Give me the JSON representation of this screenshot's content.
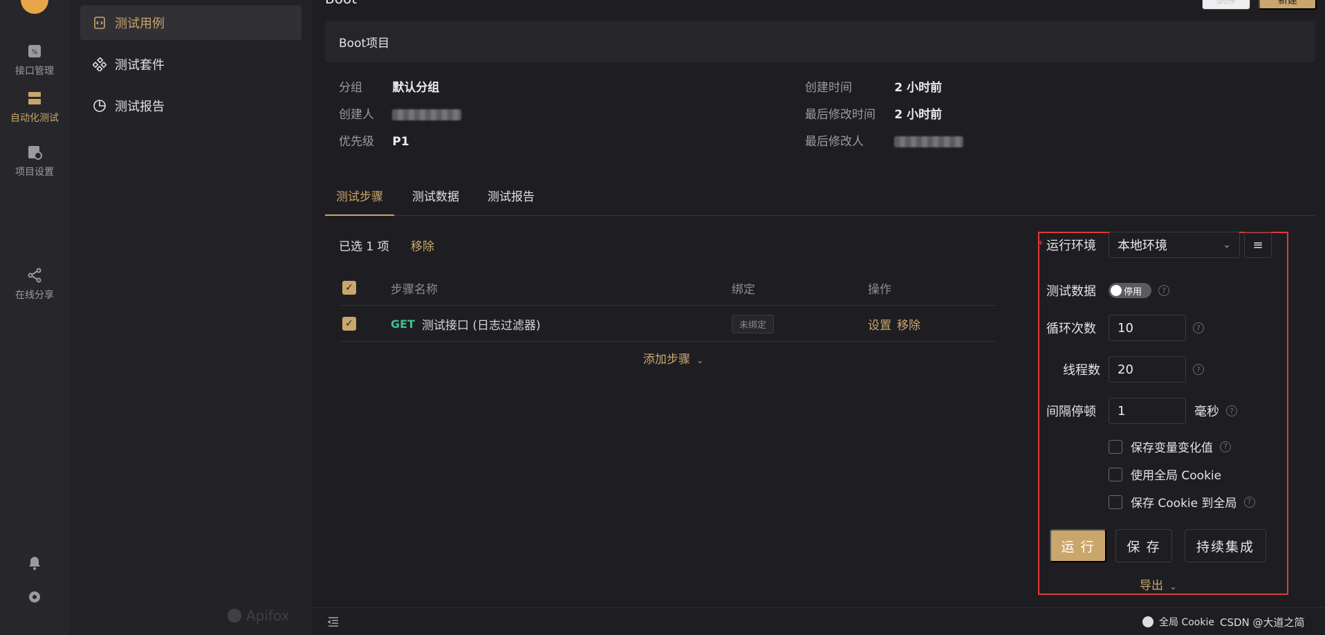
{
  "rail": {
    "items": [
      {
        "label": "接口管理",
        "icon": "api-icon"
      },
      {
        "label": "自动化测试",
        "icon": "automation-icon"
      },
      {
        "label": "项目设置",
        "icon": "settings-doc-icon"
      },
      {
        "label": "在线分享",
        "icon": "share-icon"
      }
    ],
    "active": "自动化测试"
  },
  "sidebar": {
    "items": [
      {
        "label": "测试用例",
        "icon": "test-case-icon"
      },
      {
        "label": "测试套件",
        "icon": "test-suite-icon"
      },
      {
        "label": "测试报告",
        "icon": "report-icon"
      }
    ],
    "brand": "Apifox"
  },
  "header": {
    "title": "Boot",
    "delete_label": "删除",
    "new_label": "新建"
  },
  "case": {
    "name": "Boot项目",
    "group_label": "分组",
    "group_value": "默认分组",
    "creator_label": "创建人",
    "priority_label": "优先级",
    "priority_value": "P1",
    "created_label": "创建时间",
    "created_value": "2 小时前",
    "modified_label": "最后修改时间",
    "modified_value": "2 小时前",
    "modifier_label": "最后修改人"
  },
  "tabs": [
    "测试步骤",
    "测试数据",
    "测试报告"
  ],
  "selection": {
    "text": "已选 1 项",
    "remove_label": "移除"
  },
  "table": {
    "headers": [
      "步骤名称",
      "绑定",
      "操作"
    ],
    "rows": [
      {
        "method": "GET",
        "name": "测试接口 (日志过滤器)",
        "binding": "未绑定",
        "actions": [
          "设置",
          "移除"
        ]
      }
    ],
    "add_step": "添加步骤"
  },
  "run_panel": {
    "env_label": "运行环境",
    "env_value": "本地环境",
    "data_label": "测试数据",
    "data_toggle": "停用",
    "loops_label": "循环次数",
    "loops_value": "10",
    "threads_label": "线程数",
    "threads_value": "20",
    "interval_label": "间隔停顿",
    "interval_value": "1",
    "interval_unit": "毫秒",
    "checkboxes": [
      "保存变量变化值",
      "使用全局 Cookie",
      "保存 Cookie 到全局"
    ],
    "run_label": "运 行",
    "save_label": "保 存",
    "ci_label": "持续集成",
    "export_label": "导出"
  },
  "footer": {
    "cookie_label": "全局 Cookie",
    "credit": "CSDN @大道之简"
  },
  "colors": {
    "accent": "#c9a66b",
    "get_method": "#3fbf8f",
    "highlight_border": "#e03a3a",
    "background": "#1e1e22"
  }
}
